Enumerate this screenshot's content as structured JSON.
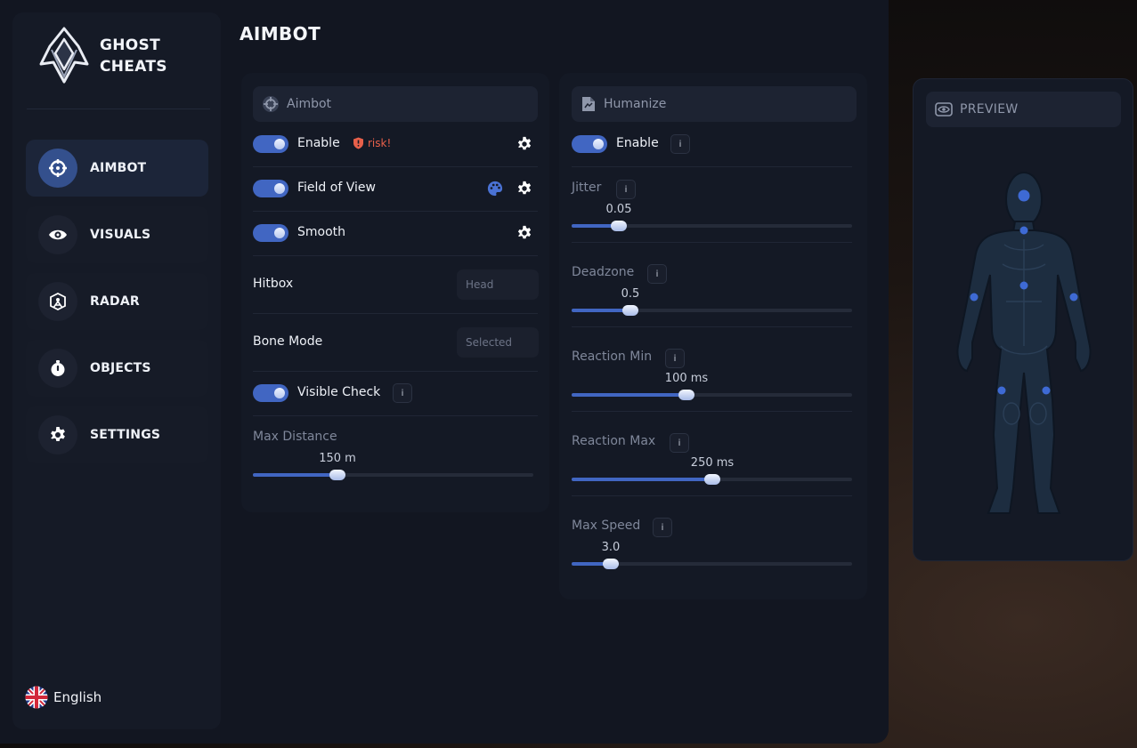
{
  "brand": {
    "line1": "GHOST",
    "line2": "CHEATS"
  },
  "nav": {
    "items": [
      {
        "label": "AIMBOT",
        "icon": "crosshair-icon",
        "active": true
      },
      {
        "label": "VISUALS",
        "icon": "eye-icon",
        "active": false
      },
      {
        "label": "RADAR",
        "icon": "radar-icon",
        "active": false
      },
      {
        "label": "OBJECTS",
        "icon": "stopwatch-icon",
        "active": false
      },
      {
        "label": "SETTINGS",
        "icon": "gear-icon",
        "active": false
      }
    ]
  },
  "language": {
    "label": "English",
    "icon": "uk-flag-icon"
  },
  "page": {
    "title": "AIMBOT"
  },
  "aimbot_panel": {
    "header": "Aimbot",
    "enable": {
      "label": "Enable",
      "on": true,
      "risk_label": "risk!"
    },
    "fov": {
      "label": "Field of View",
      "on": true
    },
    "smooth": {
      "label": "Smooth",
      "on": true
    },
    "hitbox": {
      "label": "Hitbox",
      "value": "Head"
    },
    "bone_mode": {
      "label": "Bone Mode",
      "value": "Selected"
    },
    "visible_check": {
      "label": "Visible Check",
      "on": true,
      "info": "i"
    },
    "max_distance": {
      "label": "Max Distance",
      "display": "150 m",
      "fraction": 0.3
    }
  },
  "humanize_panel": {
    "header": "Humanize",
    "enable": {
      "label": "Enable",
      "on": true,
      "info": "i"
    },
    "sliders": [
      {
        "label": "Jitter",
        "info": "i",
        "display": "0.05",
        "fraction": 0.167
      },
      {
        "label": "Deadzone",
        "info": "i",
        "display": "0.5",
        "fraction": 0.21
      },
      {
        "label": "Reaction Min",
        "info": "i",
        "display": "100 ms",
        "fraction": 0.41
      },
      {
        "label": "Reaction Max",
        "info": "i",
        "display": "250 ms",
        "fraction": 0.5
      },
      {
        "label": "Max Speed",
        "info": "i",
        "display": "3.0",
        "fraction": 0.14
      }
    ]
  },
  "preview": {
    "header": "PREVIEW"
  },
  "colors": {
    "accent": "#4166c2",
    "risk": "#e8604a",
    "background": "#121621"
  }
}
